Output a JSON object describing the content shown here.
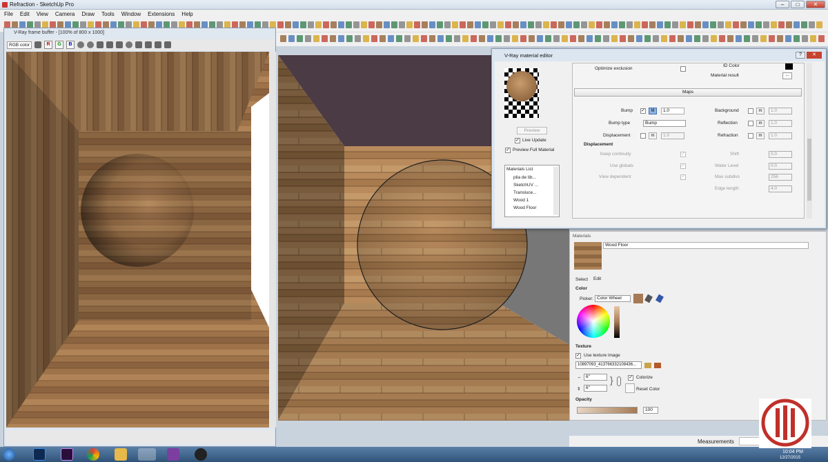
{
  "window": {
    "title": "Refraction - SketchUp Pro",
    "controls": [
      "–",
      "□",
      "✕"
    ]
  },
  "menu": [
    "File",
    "Edit",
    "View",
    "Camera",
    "Draw",
    "Tools",
    "Window",
    "Extensions",
    "Help"
  ],
  "vfb": {
    "title": "V-Ray frame buffer - [100% of 800 x 1000]",
    "channel_select": "RGB color",
    "channels": [
      "R",
      "G",
      "B"
    ]
  },
  "material_editor": {
    "title": "V-Ray material editor",
    "preview_button": "Preview",
    "live_update": "Live Update",
    "preview_full": "Preview Full Material",
    "materials_list_title": "Materials List",
    "materials_list": [
      "pila de lib...",
      "SketchUV ...",
      "Transluce...",
      "Wood 1",
      "Wood Floor"
    ],
    "optimize_exclusion": "Optimize exclusion",
    "id_color": "ID Color",
    "material_result": "Material result",
    "material_result_btn": "...",
    "maps_header": "Maps",
    "bump": {
      "label": "Bump",
      "m": "M",
      "value": "1.0"
    },
    "bump_type": {
      "label": "Bump type",
      "value": "Bump"
    },
    "displacement_row": {
      "label": "Displacement",
      "m": "m",
      "value": "1.0"
    },
    "background": {
      "label": "Background",
      "m": "m",
      "value": "1.0"
    },
    "reflection": {
      "label": "Reflection",
      "m": "m",
      "value": "1.0"
    },
    "refraction": {
      "label": "Refraction",
      "m": "m",
      "value": "1.0"
    },
    "displacement_section": "Displacement",
    "keep_continuity": "Keep continuity",
    "use_globals": "Use globals",
    "view_dependent": "View dependent",
    "shift": {
      "label": "Shift",
      "value": "0.0"
    },
    "water_level": {
      "label": "Water Level",
      "value": "0.0"
    },
    "max_subdivs": {
      "label": "Max subdivs",
      "value": "256"
    },
    "edge_length": {
      "label": "Edge length",
      "value": "4.0"
    }
  },
  "materials_panel": {
    "title": "Materials",
    "material_name": "Wood Floor",
    "tabs": [
      "Select",
      "Edit"
    ],
    "color_header": "Color",
    "picker_label": "Picker:",
    "picker_value": "Color Wheel",
    "texture_header": "Texture",
    "use_texture": "Use texture image",
    "texture_file": "10897093_413766332108436...",
    "width": "6\"",
    "height": "6\"",
    "colorize": "Colorize",
    "reset_color": "Reset Color",
    "opacity_header": "Opacity",
    "opacity_value": "100",
    "swatch_color": "#a57a55"
  },
  "status": {
    "measurements": "Measurements"
  },
  "clock": {
    "time": "10:04 PM",
    "date": "12/27/2015"
  }
}
